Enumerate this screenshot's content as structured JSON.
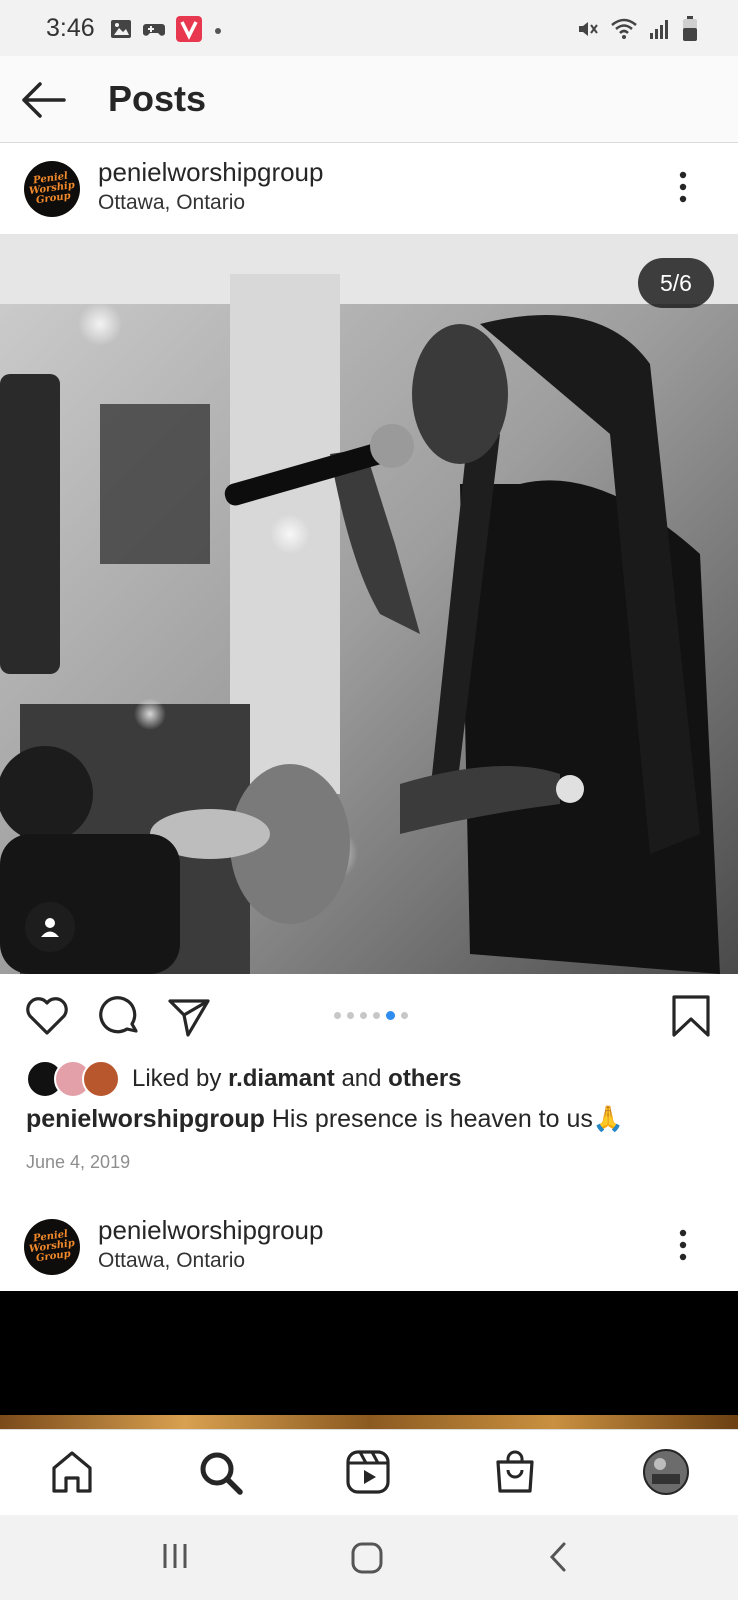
{
  "status_bar": {
    "time": "3:46",
    "left_icons": [
      "image-icon",
      "game-controller-icon",
      "v-app-icon",
      "dot-icon"
    ],
    "right_icons": [
      "mute-icon",
      "wifi-icon",
      "signal-icon",
      "battery-icon"
    ]
  },
  "app_bar": {
    "title": "Posts",
    "back_icon": "back-arrow-icon"
  },
  "post": {
    "username": "penielworshipgroup",
    "location": "Ottawa, Ontario",
    "avatar_text": [
      "Peniel",
      "Worship",
      "Group"
    ],
    "image_counter": "5/6",
    "carousel_total": 6,
    "carousel_active_index": 4,
    "liked_by_prefix": "Liked by",
    "liked_by_user": "r.diamant",
    "liked_by_and": "and",
    "liked_by_others": "others",
    "caption_user": "penielworshipgroup",
    "caption_text": "His presence is heaven to us",
    "caption_emoji": "🙏",
    "date": "June 4, 2019"
  },
  "next_post": {
    "username": "penielworshipgroup",
    "location": "Ottawa, Ontario",
    "avatar_text": [
      "Peniel",
      "Worship",
      "Group"
    ]
  },
  "bottom_nav": [
    "home-icon",
    "search-icon",
    "reels-icon",
    "shop-icon",
    "profile-avatar"
  ],
  "system_nav": [
    "recent-apps-icon",
    "home-circle-icon",
    "back-chevron-icon"
  ],
  "colors": {
    "accent_blue": "#2f8cf0",
    "logo_orange": "#f28a2c",
    "text": "#262626",
    "muted": "#8e8e8e"
  }
}
